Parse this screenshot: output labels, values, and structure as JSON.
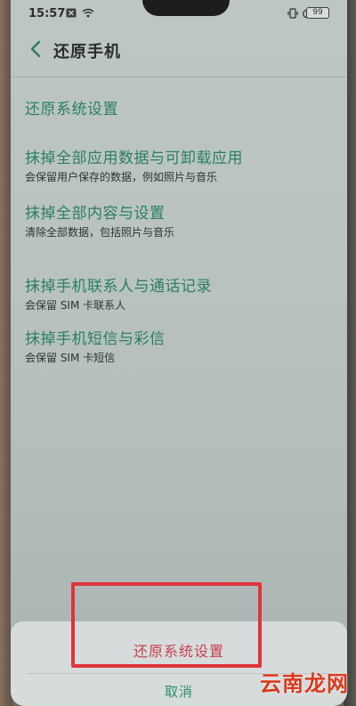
{
  "status_bar": {
    "time": "15:57",
    "icons": [
      "close-box-icon",
      "wifi-icon",
      "vibrate-icon",
      "alarm-icon",
      "bluetooth-icon"
    ],
    "battery": "99"
  },
  "header": {
    "title": "还原手机",
    "back_icon": "chevron-left-icon"
  },
  "options": [
    {
      "title": "还原系统设置",
      "subtitle": ""
    },
    {
      "title": "抹掉全部应用数据与可卸载应用",
      "subtitle": "会保留用户保存的数据，例如照片与音乐"
    },
    {
      "title": "抹掉全部内容与设置",
      "subtitle": "清除全部数据，包括照片与音乐"
    },
    {
      "title": "抹掉手机联系人与通话记录",
      "subtitle": "会保留 SIM 卡联系人"
    },
    {
      "title": "抹掉手机短信与彩信",
      "subtitle": "会保留 SIM 卡短信"
    }
  ],
  "sheet": {
    "confirm_label": "还原系统设置",
    "cancel_label": "取消"
  },
  "watermark": "云南龙网",
  "colors": {
    "accent_green": "#2a7f63",
    "confirm_red": "#c94250",
    "highlight_red": "#e0343a"
  }
}
